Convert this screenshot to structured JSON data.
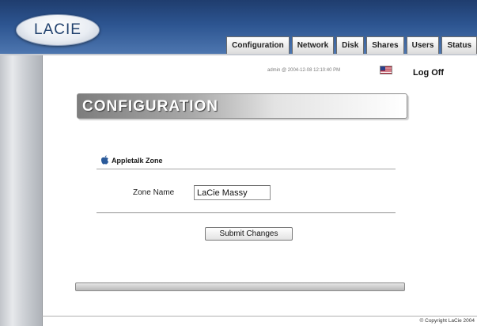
{
  "brand": {
    "logo_text": "LACIE"
  },
  "nav": {
    "tabs": [
      {
        "label": "Configuration"
      },
      {
        "label": "Network"
      },
      {
        "label": "Disk"
      },
      {
        "label": "Shares"
      },
      {
        "label": "Users"
      },
      {
        "label": "Status"
      }
    ]
  },
  "session": {
    "status_text": "admin @ 2004-12-08 12:10:40 PM",
    "logoff_label": "Log Off"
  },
  "page": {
    "title": "CONFIGURATION"
  },
  "appletalk": {
    "section_title": "Appletalk Zone",
    "zone_name_label": "Zone Name",
    "zone_name_value": "LaCie Massy",
    "submit_label": "Submit Changes"
  },
  "footer": {
    "copyright": "© Copyright LaCie 2004"
  },
  "colors": {
    "header_top": "#1f3d6e",
    "header_bottom": "#4f78b1",
    "banner_dark": "#7d7d7d"
  },
  "icons": {
    "section_icon": "apple-icon",
    "language_icon": "us-flag-icon"
  }
}
